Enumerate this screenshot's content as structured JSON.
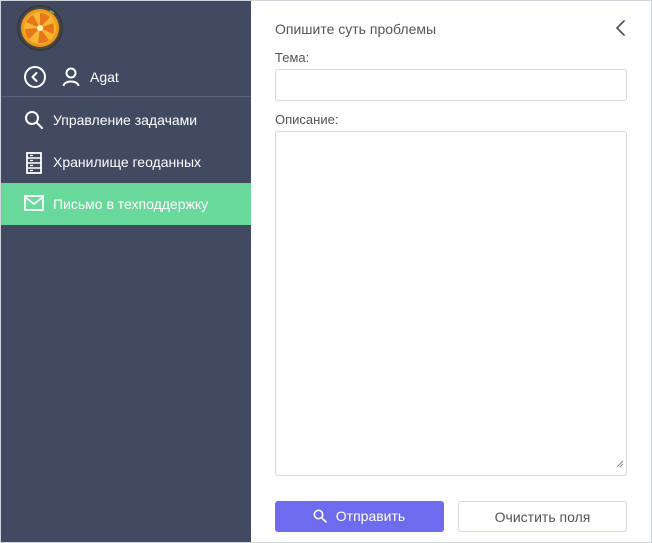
{
  "sidebar": {
    "logo_icon": "orange-slice-logo-icon",
    "user": {
      "name": "Agat",
      "back_icon": "back-circle-icon",
      "user_icon": "user-icon"
    },
    "items": [
      {
        "label": "Управление задачами",
        "icon": "search-icon",
        "active": false
      },
      {
        "label": "Хранилище геоданных",
        "icon": "storage-icon",
        "active": false
      },
      {
        "label": "Письмо в техподдержку",
        "icon": "mail-icon",
        "active": true
      }
    ],
    "colors": {
      "background": "#424a62",
      "active": "#68d99a"
    }
  },
  "main": {
    "title": "Опишите суть проблемы",
    "close_icon": "chevron-left-icon",
    "subject_label": "Тема",
    "description_label": "Описание",
    "send_label": "Отправить",
    "clear_label": "Очистить поля",
    "colors": {
      "primary": "#6e6bef"
    }
  }
}
